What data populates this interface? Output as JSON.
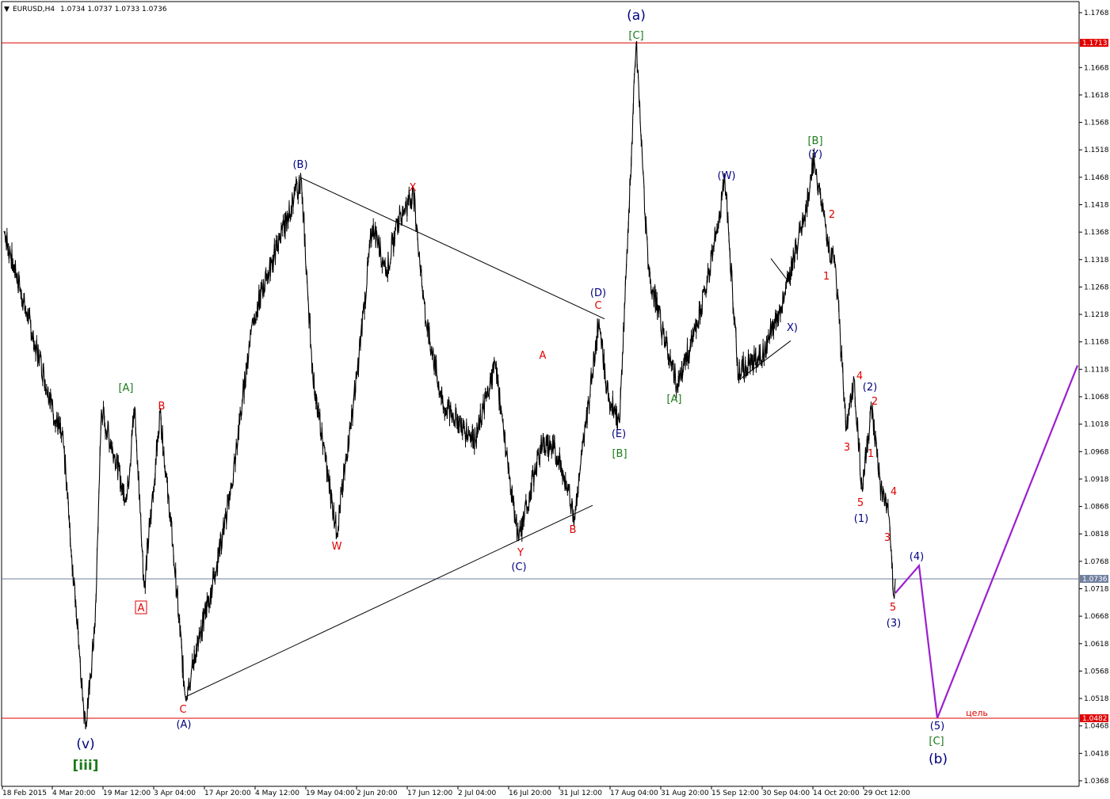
{
  "chart_data": {
    "type": "line",
    "title": "EURUSD,H4  1.0734 1.0737 1.0733 1.0736",
    "symbol_header": "EURUSD,H4",
    "ohlc_header": "1.0734 1.0737 1.0733 1.0736",
    "ylim": [
      1.0368,
      1.1768
    ],
    "y_ticks": [
      "1.1768",
      "1.1668",
      "1.1618",
      "1.1568",
      "1.1518",
      "1.1468",
      "1.1418",
      "1.1368",
      "1.1318",
      "1.1268",
      "1.1218",
      "1.1168",
      "1.1118",
      "1.1068",
      "1.1018",
      "1.0968",
      "1.0918",
      "1.0868",
      "1.0818",
      "1.0768",
      "1.0718",
      "1.0668",
      "1.0618",
      "1.0568",
      "1.0518",
      "1.0468",
      "1.0418",
      "1.0368"
    ],
    "x_ticks": [
      "18 Feb 2015",
      "4 Mar 20:00",
      "19 Mar 12:00",
      "3 Apr 04:00",
      "17 Apr 20:00",
      "4 May 12:00",
      "19 May 04:00",
      "2 Jun 20:00",
      "17 Jun 12:00",
      "2 Jul 04:00",
      "16 Jul 20:00",
      "31 Jul 12:00",
      "17 Aug 04:00",
      "31 Aug 20:00",
      "15 Sep 12:00",
      "30 Sep 04:00",
      "14 Oct 20:00",
      "29 Oct 12:00"
    ],
    "grid": false,
    "horizontal_levels": [
      {
        "value": 1.1713,
        "label": "1.1713",
        "color": "#e00000"
      },
      {
        "value": 1.0482,
        "label": "1.0482",
        "color": "#e00000"
      },
      {
        "value": 1.0736,
        "label": "1.0736",
        "color": "#6f7f9f"
      }
    ],
    "price_series": {
      "name": "EURUSD H4",
      "color": "#000000",
      "points": [
        [
          "18 Feb 2015",
          1.137
        ],
        [
          "4 Mar 20:00",
          1.098
        ],
        [
          "9 Mar",
          1.0462
        ],
        [
          "12 Mar",
          1.065
        ],
        [
          "17 Mar",
          1.1045
        ],
        [
          "19 Mar 12:00",
          1.088
        ],
        [
          "24 Mar",
          1.105
        ],
        [
          "26 Mar",
          1.072
        ],
        [
          "1 Apr",
          1.104
        ],
        [
          "3 Apr 04:00",
          1.08
        ],
        [
          "13 Apr",
          1.0521
        ],
        [
          "17 Apr 20:00",
          1.075
        ],
        [
          "22 Apr",
          1.09
        ],
        [
          "30 Apr",
          1.12
        ],
        [
          "4 May 12:00",
          1.13
        ],
        [
          "15 May",
          1.1467
        ],
        [
          "19 May 04:00",
          1.11
        ],
        [
          "27 May",
          1.082
        ],
        [
          "2 Jun 20:00",
          1.11
        ],
        [
          "5 Jun",
          1.138
        ],
        [
          "10 Jun",
          1.13
        ],
        [
          "17 Jun 12:00",
          1.14
        ],
        [
          "18 Jun",
          1.1436
        ],
        [
          "25 Jun",
          1.12
        ],
        [
          "2 Jul 04:00",
          1.105
        ],
        [
          "8 Jul",
          1.099
        ],
        [
          "13 Jul",
          1.113
        ],
        [
          "16 Jul 20:00",
          1.09
        ],
        [
          "20 Jul",
          1.0808
        ],
        [
          "24 Jul",
          1.099
        ],
        [
          "31 Jul 12:00",
          1.096
        ],
        [
          "5 Aug",
          1.085
        ],
        [
          "12 Aug",
          1.121
        ],
        [
          "14 Aug",
          1.108
        ],
        [
          "17 Aug 04:00",
          1.102
        ],
        [
          "24 Aug",
          1.1713
        ],
        [
          "26 Aug",
          1.13
        ],
        [
          "31 Aug 20:00",
          1.119
        ],
        [
          "3 Sep",
          1.109
        ],
        [
          "8 Sep",
          1.12
        ],
        [
          "15 Sep 12:00",
          1.13
        ],
        [
          "18 Sep",
          1.146
        ],
        [
          "23 Sep",
          1.111
        ],
        [
          "30 Sep 04:00",
          1.115
        ],
        [
          "6 Oct",
          1.125
        ],
        [
          "14 Oct 20:00",
          1.14
        ],
        [
          "15 Oct",
          1.1495
        ],
        [
          "20 Oct",
          1.135
        ],
        [
          "22 Oct",
          1.13
        ],
        [
          "26 Oct",
          1.101
        ],
        [
          "27 Oct",
          1.11
        ],
        [
          "28 Oct",
          1.09
        ],
        [
          "29 Oct 12:00",
          1.105
        ],
        [
          "3 Nov",
          1.09
        ],
        [
          "5 Nov",
          1.085
        ],
        [
          "6 Nov",
          1.0705
        ],
        [
          "latest",
          1.0736
        ]
      ]
    },
    "forecast_series": {
      "name": "",
      "color": "#9b1fd0",
      "points": [
        [
          "6 Nov",
          1.071
        ],
        [
          "(4)",
          1.076
        ],
        [
          "(5)",
          1.0482
        ],
        [
          "target",
          1.1125
        ]
      ]
    },
    "trend_lines": [
      {
        "from": [
          "3 Apr",
          1.0521
        ],
        "to": [
          "4 Aug",
          1.087
        ]
      },
      {
        "from": [
          "15 May",
          1.1467
        ],
        "to": [
          "5 Aug",
          1.121
        ]
      },
      {
        "from": [
          "24 Sep",
          1.11
        ],
        "to": [
          "2 Oct",
          1.117
        ]
      },
      {
        "from": [
          "29 Sep",
          1.132
        ],
        "to": [
          "2 Oct",
          1.128
        ]
      }
    ],
    "wave_labels": [
      {
        "text": "(a)",
        "color": "#000080",
        "size": "big"
      },
      {
        "text": "[C]",
        "color": "#1a7a1a"
      },
      {
        "text": "(B)",
        "color": "#000080"
      },
      {
        "text": "X",
        "color": "#e00000"
      },
      {
        "text": "(D)",
        "color": "#000080"
      },
      {
        "text": "C",
        "color": "#e00000"
      },
      {
        "text": "(W)",
        "color": "#000080"
      },
      {
        "text": "[B]",
        "color": "#1a7a1a"
      },
      {
        "text": "(Y)",
        "color": "#000080"
      },
      {
        "text": "2",
        "color": "#e00000"
      },
      {
        "text": "1",
        "color": "#e00000"
      },
      {
        "text": "X)",
        "color": "#000080"
      },
      {
        "text": "A",
        "color": "#e00000"
      },
      {
        "text": "[A]",
        "color": "#1a7a1a"
      },
      {
        "text": "B",
        "color": "#e00000"
      },
      {
        "text": "(E)",
        "color": "#000080"
      },
      {
        "text": "[B]",
        "color": "#1a7a1a"
      },
      {
        "text": "[A]",
        "color": "#1a7a1a"
      },
      {
        "text": "4",
        "color": "#e00000"
      },
      {
        "text": "(2)",
        "color": "#000080"
      },
      {
        "text": "2",
        "color": "#e00000"
      },
      {
        "text": "3",
        "color": "#e00000"
      },
      {
        "text": "1",
        "color": "#e00000"
      },
      {
        "text": "5",
        "color": "#e00000"
      },
      {
        "text": "(1)",
        "color": "#000080"
      },
      {
        "text": "4",
        "color": "#e00000"
      },
      {
        "text": "3",
        "color": "#e00000"
      },
      {
        "text": "W",
        "color": "#e00000"
      },
      {
        "text": "Y",
        "color": "#e00000"
      },
      {
        "text": "(C)",
        "color": "#000080"
      },
      {
        "text": "B",
        "color": "#e00000"
      },
      {
        "text": "A",
        "color": "#e00000"
      },
      {
        "text": "C",
        "color": "#e00000"
      },
      {
        "text": "(A)",
        "color": "#000080"
      },
      {
        "text": "(v)",
        "color": "#000080",
        "size": "big"
      },
      {
        "text": "[iii]",
        "color": "#1a7a1a",
        "size": "big"
      },
      {
        "text": "(4)",
        "color": "#000080"
      },
      {
        "text": "5",
        "color": "#e00000"
      },
      {
        "text": "(3)",
        "color": "#000080"
      },
      {
        "text": "цель",
        "color": "#e00000"
      },
      {
        "text": "(5)",
        "color": "#000080"
      },
      {
        "text": "[C]",
        "color": "#1a7a1a"
      },
      {
        "text": "(b)",
        "color": "#000080",
        "size": "big"
      }
    ]
  }
}
